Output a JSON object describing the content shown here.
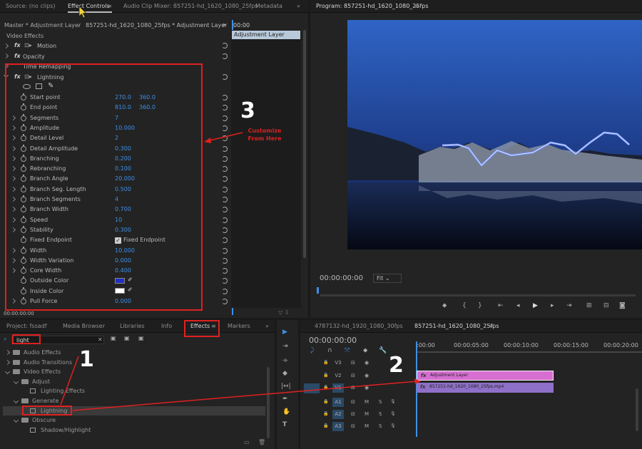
{
  "effect_controls": {
    "tabs": [
      "Source: (no clips)",
      "Effect Controls",
      "Audio Clip Mixer: 857251-hd_1620_1080_25fps",
      "Metadata"
    ],
    "master_label": "Master * Adjustment Layer",
    "clip_path": "857251-hd_1620_1080_25fps * Adjustment Layer",
    "timecode_start": "00:00",
    "clip_bar_label": "Adjustment Layer",
    "section": "Video Effects",
    "effects": [
      "Motion",
      "Opacity",
      "Time Remapping",
      "Lightning"
    ],
    "properties": [
      {
        "name": "Start point",
        "v1": "270.0",
        "v2": "360.0",
        "chev": false
      },
      {
        "name": "End point",
        "v1": "810.0",
        "v2": "360.0",
        "chev": false
      },
      {
        "name": "Segments",
        "v1": "7",
        "v2": "",
        "chev": true
      },
      {
        "name": "Amplitude",
        "v1": "10.000",
        "v2": "",
        "chev": true
      },
      {
        "name": "Detail Level",
        "v1": "2",
        "v2": "",
        "chev": true
      },
      {
        "name": "Detail Amplitude",
        "v1": "0.300",
        "v2": "",
        "chev": true
      },
      {
        "name": "Branching",
        "v1": "0.200",
        "v2": "",
        "chev": true
      },
      {
        "name": "Rebranching",
        "v1": "0.100",
        "v2": "",
        "chev": true
      },
      {
        "name": "Branch Angle",
        "v1": "20.000",
        "v2": "",
        "chev": true
      },
      {
        "name": "Branch Seg. Length",
        "v1": "0.500",
        "v2": "",
        "chev": true
      },
      {
        "name": "Branch Segments",
        "v1": "4",
        "v2": "",
        "chev": true
      },
      {
        "name": "Branch Width",
        "v1": "0.700",
        "v2": "",
        "chev": true
      },
      {
        "name": "Speed",
        "v1": "10",
        "v2": "",
        "chev": true
      },
      {
        "name": "Stability",
        "v1": "0.300",
        "v2": "",
        "chev": true
      },
      {
        "name": "Fixed Endpoint",
        "v1": "Fixed Endpoint",
        "v2": "",
        "chev": false
      },
      {
        "name": "Width",
        "v1": "10.000",
        "v2": "",
        "chev": true
      },
      {
        "name": "Width Variation",
        "v1": "0.000",
        "v2": "",
        "chev": true
      },
      {
        "name": "Core Width",
        "v1": "0.400",
        "v2": "",
        "chev": true
      },
      {
        "name": "Outside Color",
        "v1": "",
        "v2": "",
        "chev": false
      },
      {
        "name": "Inside Color",
        "v1": "",
        "v2": "",
        "chev": false
      },
      {
        "name": "Pull Force",
        "v1": "0.000",
        "v2": "",
        "chev": true
      }
    ],
    "bottom_timecode": "00:00:00:00"
  },
  "program": {
    "title": "Program: 857251-hd_1620_1080_25fps",
    "timecode": "00:00:00:00",
    "fit": "Fit"
  },
  "project": {
    "tabs": [
      "Project: fssadf",
      "Media Browser",
      "Libraries",
      "Info",
      "Effects",
      "Markers"
    ],
    "search_value": "light",
    "tree": [
      {
        "label": "Audio Effects",
        "indent": 0,
        "type": "folder"
      },
      {
        "label": "Audio Transitions",
        "indent": 0,
        "type": "folder"
      },
      {
        "label": "Video Effects",
        "indent": 0,
        "type": "folder"
      },
      {
        "label": "Adjust",
        "indent": 1,
        "type": "folder"
      },
      {
        "label": "Lighting Effects",
        "indent": 2,
        "type": "effect"
      },
      {
        "label": "Generate",
        "indent": 1,
        "type": "folder"
      },
      {
        "label": "Lightning",
        "indent": 2,
        "type": "effect"
      },
      {
        "label": "Obscure",
        "indent": 1,
        "type": "folder"
      },
      {
        "label": "Shadow/Highlight",
        "indent": 2,
        "type": "effect"
      }
    ]
  },
  "timeline": {
    "tabs": [
      "4787132-hd_1920_1080_30fps",
      "857251-hd_1620_1080_25fps"
    ],
    "timecode": "00:00:00:00",
    "ruler": [
      ":00:00",
      "00:00:05:00",
      "00:00:10:00",
      "00:00:15:00",
      "00:00:20:00"
    ],
    "tracks": [
      "V3",
      "V2",
      "V1",
      "A1",
      "A2",
      "A3"
    ],
    "clip_adjustment": "Adjustment Layer",
    "clip_video": "857251-hd_1620_1080_25fps.mp4"
  },
  "annotations": {
    "n1": "1",
    "n2": "2",
    "n3": "3",
    "customize_line1": "Customize",
    "customize_line2": "From Here"
  },
  "colors": {
    "accent_blue": "#3f8fe6",
    "annotation_red": "#e02020",
    "clip_pink": "#d66fd1",
    "clip_purple": "#8f70c8"
  }
}
